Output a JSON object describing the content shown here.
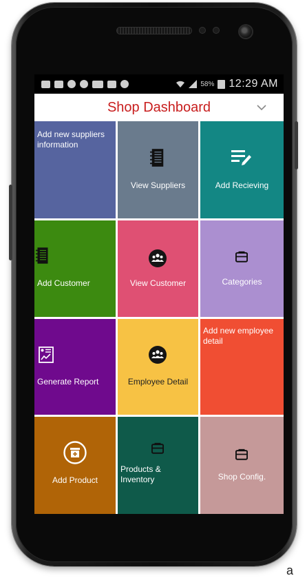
{
  "status_bar": {
    "battery": "58%",
    "time": "12:29 AM"
  },
  "header": {
    "title": "Shop Dashboard",
    "chevron_icon": "chevron-down-icon"
  },
  "tiles": [
    {
      "label": "Add new suppliers information",
      "color": "#56649f",
      "icon": ""
    },
    {
      "label": "View Suppliers",
      "color": "#6a7b8d",
      "icon": "notebook-icon"
    },
    {
      "label": "Add Recieving",
      "color": "#138784",
      "icon": "edit-list-icon"
    },
    {
      "label": "Add Customer",
      "color": "#3c8a10",
      "icon": "notebook-icon"
    },
    {
      "label": "View Customer",
      "color": "#df5073",
      "icon": "group-icon"
    },
    {
      "label": "Categories",
      "color": "#ab8fd0",
      "icon": "briefcase-icon"
    },
    {
      "label": "Generate Report",
      "color": "#6f0a8d",
      "icon": "report-icon"
    },
    {
      "label": "Employee Detail",
      "color": "#f7c244",
      "icon": "group-icon"
    },
    {
      "label": "Add new employee detail",
      "color": "#f04e33",
      "icon": ""
    },
    {
      "label": "Add Product",
      "color": "#b06407",
      "icon": "add-box-icon"
    },
    {
      "label": "Products & Inventory",
      "color": "#0f5a4a",
      "icon": "briefcase-icon"
    },
    {
      "label": "Shop Config.",
      "color": "#c59999",
      "icon": "briefcase-icon"
    }
  ],
  "footer_text": "a"
}
